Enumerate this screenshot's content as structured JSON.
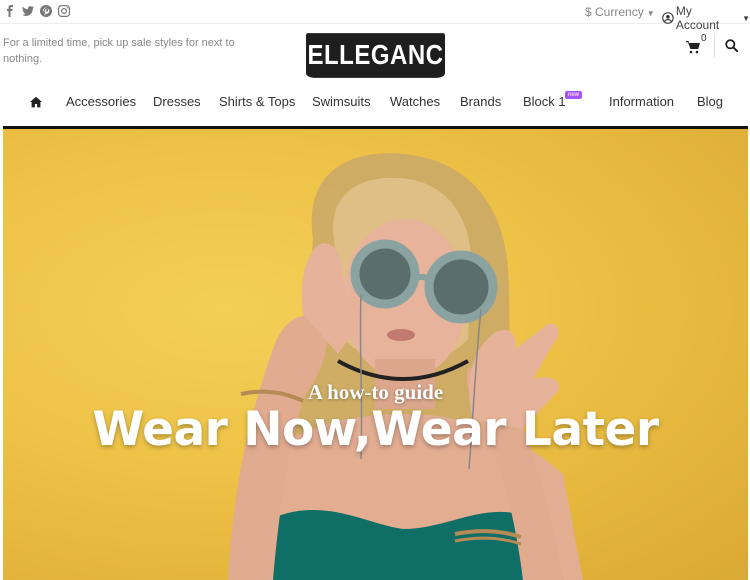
{
  "topbar": {
    "social_icons": [
      "facebook-icon",
      "twitter-icon",
      "pinterest-icon",
      "instagram-icon"
    ],
    "currency_label": "$ Currency",
    "account_label": "My Account"
  },
  "header": {
    "promo_text": "For a limited time, pick up sale styles for next to nothing.",
    "logo_text": "SELLEGANCE",
    "cart_count": "0"
  },
  "nav": {
    "items": [
      {
        "label": "Accessories"
      },
      {
        "label": "Dresses"
      },
      {
        "label": "Shirts & Tops"
      },
      {
        "label": "Swimsuits"
      },
      {
        "label": "Watches"
      },
      {
        "label": "Brands"
      },
      {
        "label": "Block 1",
        "badge": "new"
      },
      {
        "label": "Information"
      },
      {
        "label": "Blog"
      }
    ]
  },
  "hero": {
    "subtitle": "A how-to guide",
    "title": "Wear Now,Wear Later"
  },
  "colors": {
    "hero_background": "#eec347",
    "badge": "#a855f7",
    "nav_underline": "#111111"
  }
}
